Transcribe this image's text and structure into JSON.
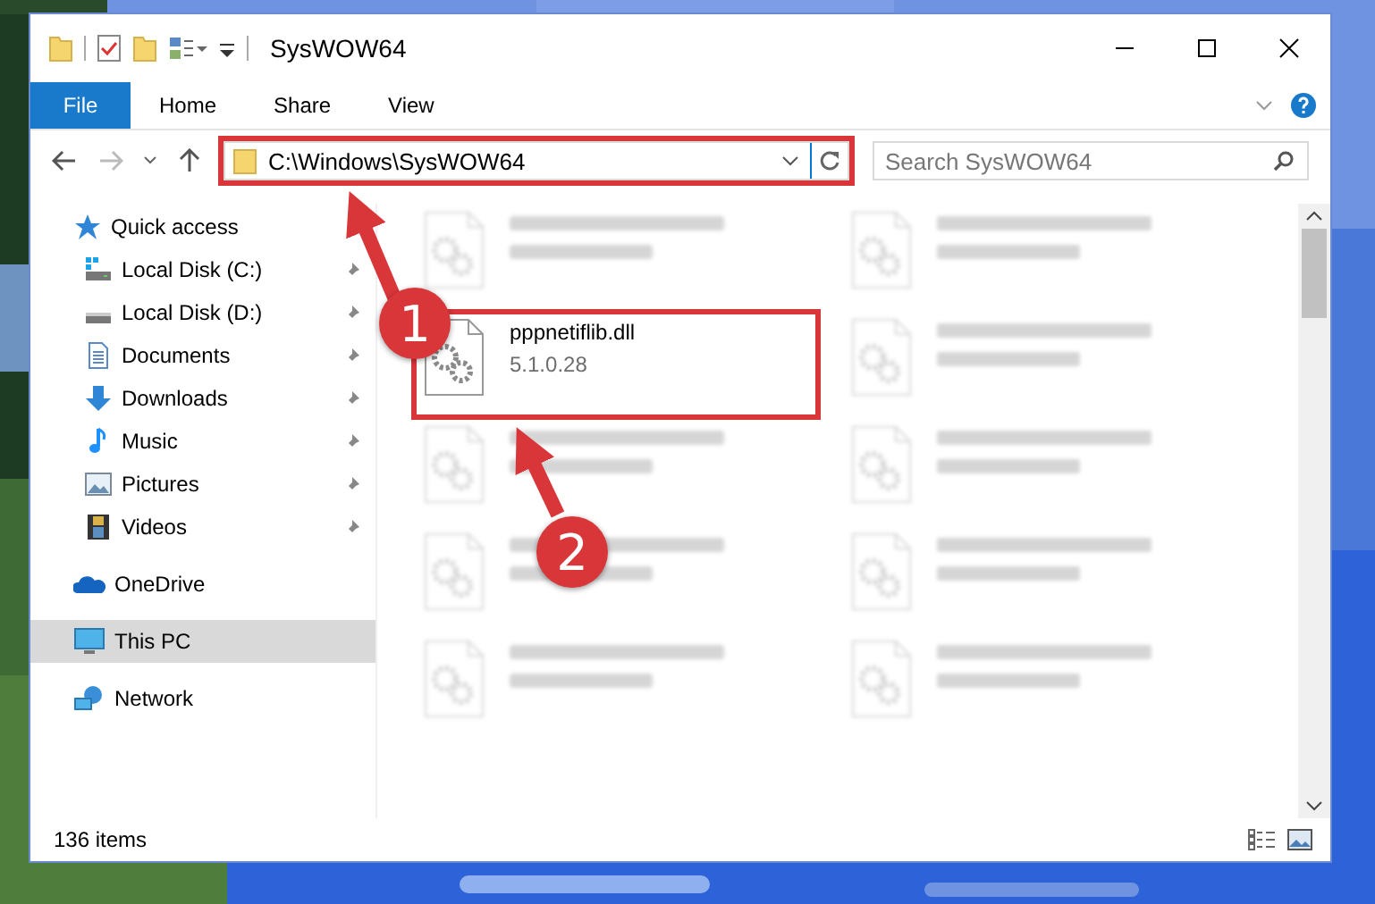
{
  "window": {
    "title": "SysWOW64"
  },
  "ribbon_tabs": [
    {
      "label": "File",
      "kind": "file",
      "selected": false
    },
    {
      "label": "Home",
      "kind": "tab",
      "selected": false
    },
    {
      "label": "Share",
      "kind": "tab",
      "selected": false
    },
    {
      "label": "View",
      "kind": "tab",
      "selected": false
    }
  ],
  "address_bar": {
    "path": "C:\\Windows\\SysWOW64",
    "highlighted": true
  },
  "search": {
    "placeholder": "Search SysWOW64"
  },
  "sidebar": {
    "items": [
      {
        "label": "Quick access",
        "kind": "star",
        "selected": false,
        "children": [
          {
            "label": "Local Disk (C:)",
            "kind": "system-drive",
            "pinned": true
          },
          {
            "label": "Local Disk (D:)",
            "kind": "drive",
            "pinned": true
          },
          {
            "label": "Documents",
            "kind": "documents",
            "pinned": true
          },
          {
            "label": "Downloads",
            "kind": "downloads",
            "pinned": true
          },
          {
            "label": "Music",
            "kind": "music",
            "pinned": true
          },
          {
            "label": "Pictures",
            "kind": "pictures",
            "pinned": true
          },
          {
            "label": "Videos",
            "kind": "videos",
            "pinned": true
          }
        ]
      },
      {
        "label": "OneDrive",
        "kind": "cloud",
        "selected": false
      },
      {
        "label": "This PC",
        "kind": "pc",
        "selected": true
      },
      {
        "label": "Network",
        "kind": "network",
        "selected": false
      }
    ]
  },
  "files": [
    {
      "blurred": true,
      "highlighted": false
    },
    {
      "blurred": true,
      "highlighted": false
    },
    {
      "name": "pppnetiflib.dll",
      "detail": "5.1.0.28",
      "blurred": false,
      "highlighted": true
    },
    {
      "blurred": true,
      "highlighted": false
    },
    {
      "blurred": true,
      "highlighted": false
    },
    {
      "blurred": true,
      "highlighted": false
    },
    {
      "blurred": true,
      "highlighted": false
    },
    {
      "blurred": true,
      "highlighted": false
    },
    {
      "blurred": true,
      "highlighted": false
    },
    {
      "blurred": true,
      "highlighted": false
    }
  ],
  "status_bar": {
    "item_count": "136 items"
  },
  "annotations": [
    {
      "number": "1"
    },
    {
      "number": "2"
    }
  ]
}
